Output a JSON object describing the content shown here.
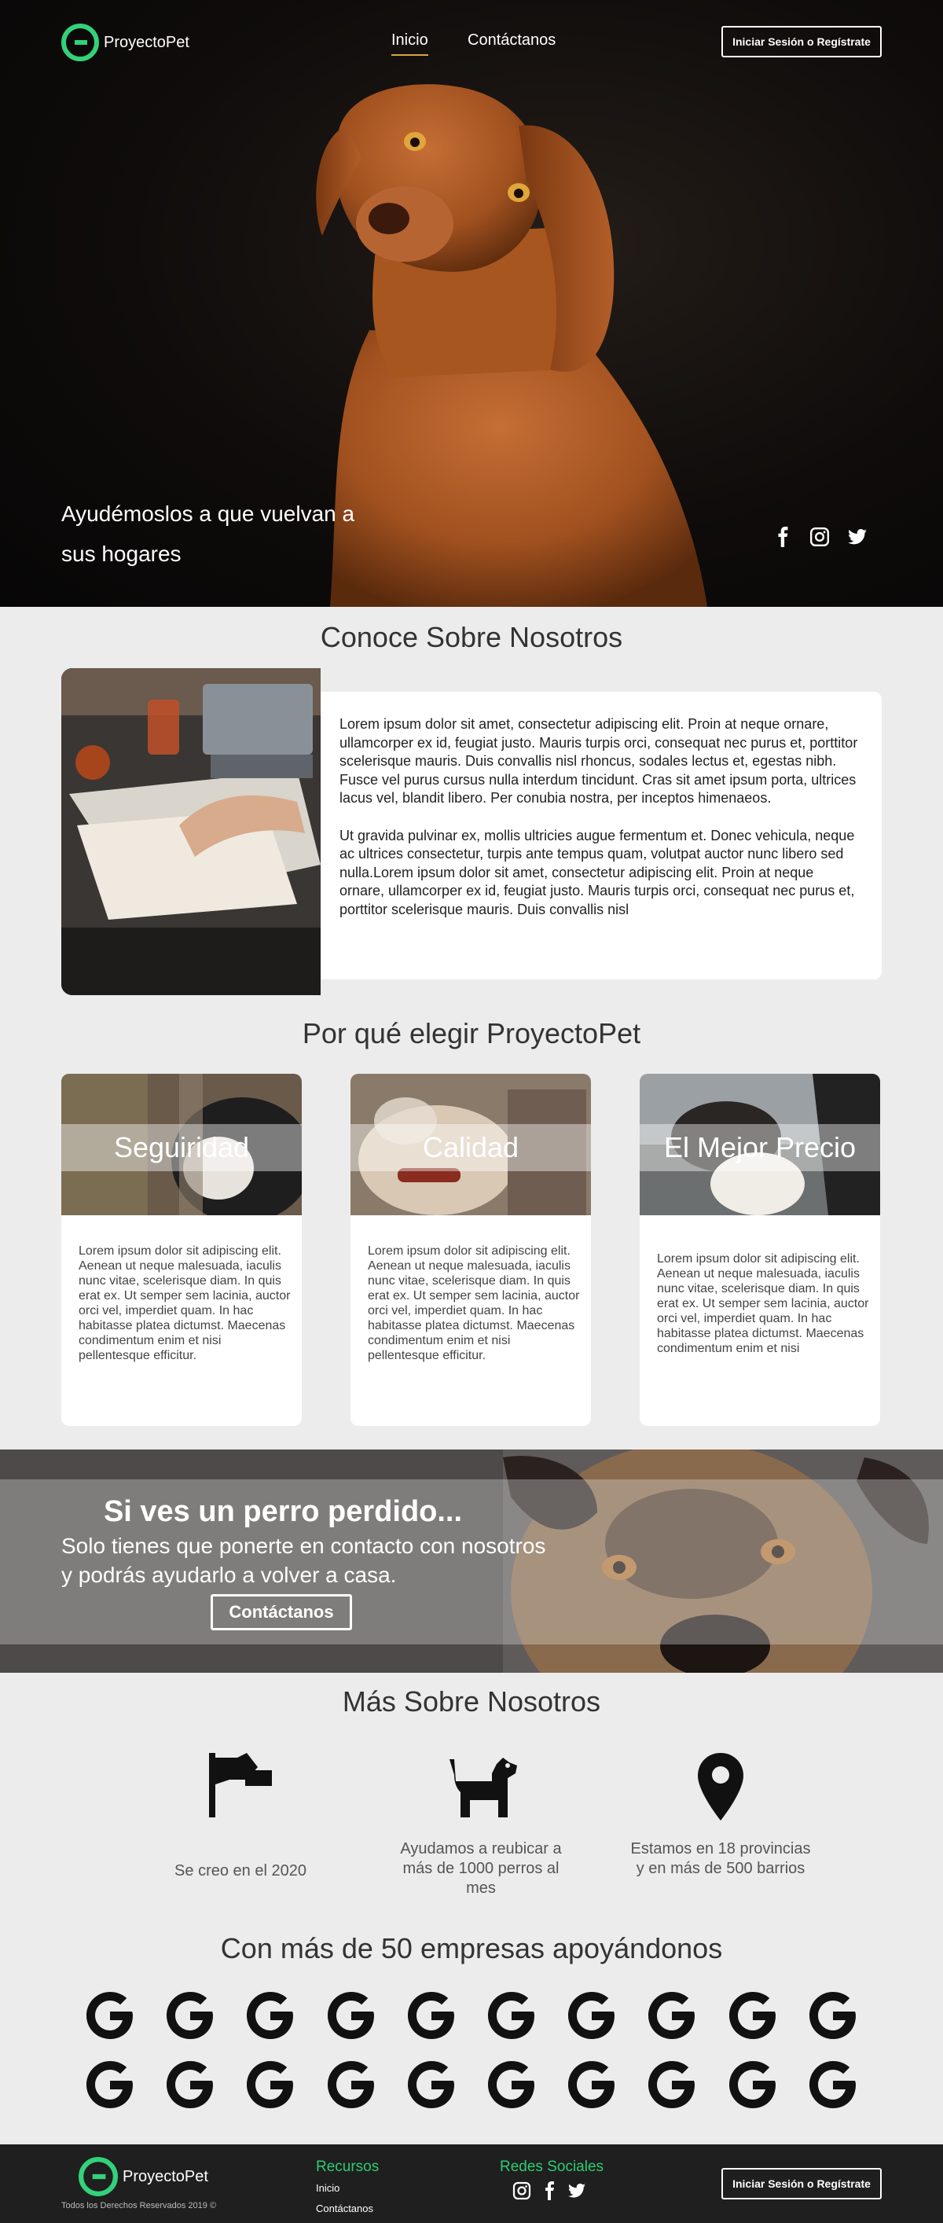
{
  "brand": {
    "name": "ProyectoPet",
    "accent": "#33d17a"
  },
  "nav": {
    "inicio": "Inicio",
    "contactanos": "Contáctanos"
  },
  "auth": {
    "login_label": "Iniciar Sesión o Regístrate"
  },
  "hero": {
    "tagline": "Ayudémoslos a que vuelvan a sus hogares"
  },
  "social_icons": [
    "facebook-icon",
    "instagram-icon",
    "twitter-icon"
  ],
  "about": {
    "title": "Conoce Sobre Nosotros",
    "paragraph1": "Lorem ipsum dolor sit amet, consectetur adipiscing elit. Proin at neque ornare, ullamcorper ex id, feugiat justo. Mauris turpis orci, consequat nec purus et, porttitor scelerisque mauris. Duis convallis nisl rhoncus, sodales lectus et, egestas nibh. Fusce vel purus cursus nulla interdum tincidunt. Cras sit amet ipsum porta, ultrices lacus vel, blandit libero. Per conubia nostra, per inceptos himenaeos.",
    "paragraph2": "Ut gravida pulvinar ex, mollis ultricies augue fermentum et. Donec vehicula, neque ac ultrices consectetur, turpis ante tempus quam, volutpat auctor nunc libero sed nulla.Lorem ipsum dolor sit amet, consectetur adipiscing elit. Proin at neque ornare, ullamcorper ex id, feugiat justo. Mauris turpis orci, consequat nec purus et, porttitor scelerisque mauris. Duis convallis nisl"
  },
  "why": {
    "title": "Por qué elegir ProyectoPet",
    "cards": [
      {
        "title": "Seguiridad",
        "text": "Lorem ipsum dolor sit  adipiscing elit. Aenean ut neque malesuada, iaculis nunc vitae, scelerisque diam. In quis erat ex. Ut semper sem lacinia, auctor orci vel, imperdiet quam. In hac habitasse platea dictumst. Maecenas condimentum enim et nisi pellentesque efficitur."
      },
      {
        "title": "Calidad",
        "text": "Lorem ipsum dolor sit  adipiscing elit. Aenean ut neque malesuada, iaculis nunc vitae, scelerisque diam. In quis erat ex. Ut semper sem lacinia, auctor orci vel, imperdiet quam. In hac habitasse platea dictumst. Maecenas condimentum enim et nisi pellentesque efficitur."
      },
      {
        "title": "El Mejor Precio",
        "text": "Lorem ipsum dolor sit  adipiscing elit. Aenean ut neque malesuada, iaculis nunc vitae, scelerisque diam. In quis erat ex. Ut semper sem lacinia, auctor orci vel, imperdiet quam. In hac habitasse platea dictumst. Maecenas condimentum enim et nisi"
      }
    ]
  },
  "banner": {
    "title": "Si ves un perro perdido...",
    "subtitle": "Solo tienes que ponerte en contacto con nosotros y podrás ayudarlo a volver a casa.",
    "button": "Contáctanos"
  },
  "more": {
    "title": "Más Sobre Nosotros",
    "items": [
      {
        "icon": "flag-icon",
        "text": "Se creo en el 2020"
      },
      {
        "icon": "dog-icon",
        "text": "Ayudamos a reubicar a más de 1000 perros al mes"
      },
      {
        "icon": "location-pin-icon",
        "text": "Estamos en 18 provincias y en más de 500 barrios"
      }
    ]
  },
  "partners": {
    "title": "Con más de 50 empresas apoyándonos",
    "logo_icon": "google-g-icon",
    "logos_shown": 20
  },
  "footer": {
    "copyright": "Todos los Derechos Reservados 2019 ©",
    "resources_heading": "Recursos",
    "links": [
      "Inicio",
      "Contáctanos"
    ],
    "social_heading": "Redes Sociales"
  }
}
